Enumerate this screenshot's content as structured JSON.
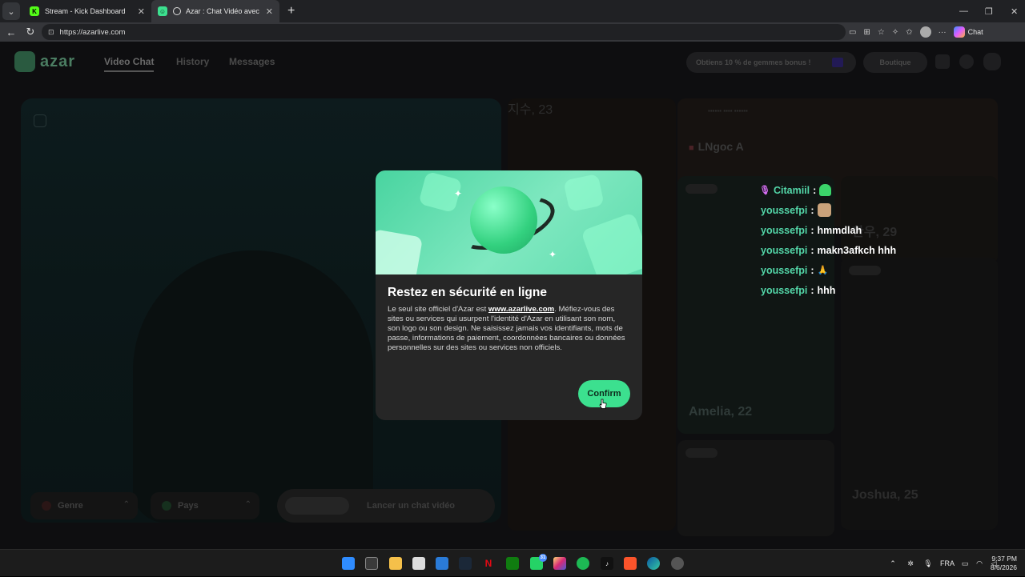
{
  "browser": {
    "tabs": [
      {
        "title": "Stream - Kick Dashboard",
        "active": false
      },
      {
        "title": "Azar : Chat Vidéo avec de nou",
        "active": true
      }
    ],
    "url": "https://azarlive.com",
    "chat_label": "Chat"
  },
  "site": {
    "logo_text": "azar",
    "nav": [
      "Video Chat",
      "History",
      "Messages"
    ],
    "promo": "Obtiens 10 % de gemmes bonus !",
    "shop": "Boutique",
    "filters": {
      "gender": "Genre",
      "country": "Pays"
    },
    "launch": "Lancer un chat vidéo",
    "featured_name": "LNgoc A",
    "cards": [
      {
        "caption": "한우, 29"
      },
      {
        "caption": "Amelia, 22"
      },
      {
        "caption": "지수, 23"
      },
      {
        "caption": "Joshua, 25"
      }
    ]
  },
  "chat": [
    {
      "user": "Citamiil",
      "message": "",
      "emote": "green-ghost",
      "mic": true
    },
    {
      "user": "youssefpi",
      "message": "",
      "emote": "cat",
      "mic": false
    },
    {
      "user": "youssefpi",
      "message": "hmmdlah",
      "emote": "",
      "mic": false
    },
    {
      "user": "youssefpi",
      "message": "makn3afkch hhh",
      "emote": "",
      "mic": false
    },
    {
      "user": "youssefpi",
      "message": "",
      "emote": "praying-hands",
      "mic": false
    },
    {
      "user": "youssefpi",
      "message": "hhh",
      "emote": "",
      "mic": false
    }
  ],
  "modal": {
    "title": "Restez en sécurité en ligne",
    "body_before": "Le seul site officiel d'Azar est ",
    "body_link": "www.azarlive.com",
    "body_after": ". Méfiez-vous des sites ou services qui usurpent l'identité d'Azar en utilisant son nom, son logo ou son design. Ne saisissez jamais vos identifiants, mots de passe, informations de paiement, coordonnées bancaires ou données personnelles sur des sites ou services non officiels.",
    "confirm": "Confirm"
  },
  "taskbar": {
    "whatsapp_badge": "31",
    "language": "FRA",
    "time": "9:37 PM",
    "date": "8/6/2026"
  },
  "colors": {
    "accent": "#3ce08f",
    "chat_username": "#53d6a8",
    "modal_bg": "#262626"
  }
}
